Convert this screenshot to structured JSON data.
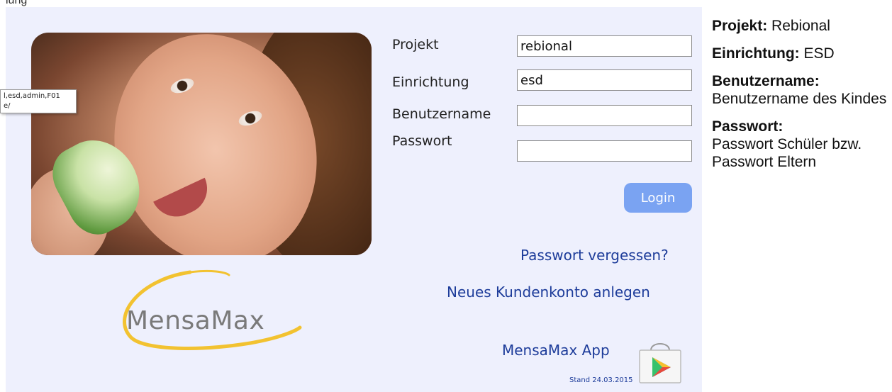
{
  "top_clip": "lung",
  "tooltip": {
    "line1": "l,esd,admin,F01",
    "line2": "e/"
  },
  "form": {
    "project_label": "Projekt",
    "project_value": "rebional",
    "institution_label": "Einrichtung",
    "institution_value": "esd",
    "username_label": "Benutzername",
    "username_value": "",
    "password_label": "Passwort",
    "password_value": "",
    "login_button": "Login"
  },
  "links": {
    "forgot_password": "Passwort vergessen?",
    "new_account": "Neues Kundenkonto anlegen",
    "app": "MensaMax App",
    "stand": "Stand 24.03.2015"
  },
  "logo": {
    "text": "MensaMax",
    "accent_color": "#f2c230"
  },
  "info": {
    "project_key": "Projekt:",
    "project_val": "Rebional",
    "institution_key": "Einrichtung:",
    "institution_val": "ESD",
    "username_key": "Benutzername:",
    "username_val": "Benutzername des Kindes",
    "password_key": "Passwort:",
    "password_val_1": "Passwort Schüler bzw.",
    "password_val_2": "Passwort Eltern"
  },
  "icons": {
    "store": "google-play-bag-icon"
  },
  "colors": {
    "panel_bg": "#eef0fd",
    "button_bg": "#7aa3f2",
    "link": "#1d3c9a"
  }
}
